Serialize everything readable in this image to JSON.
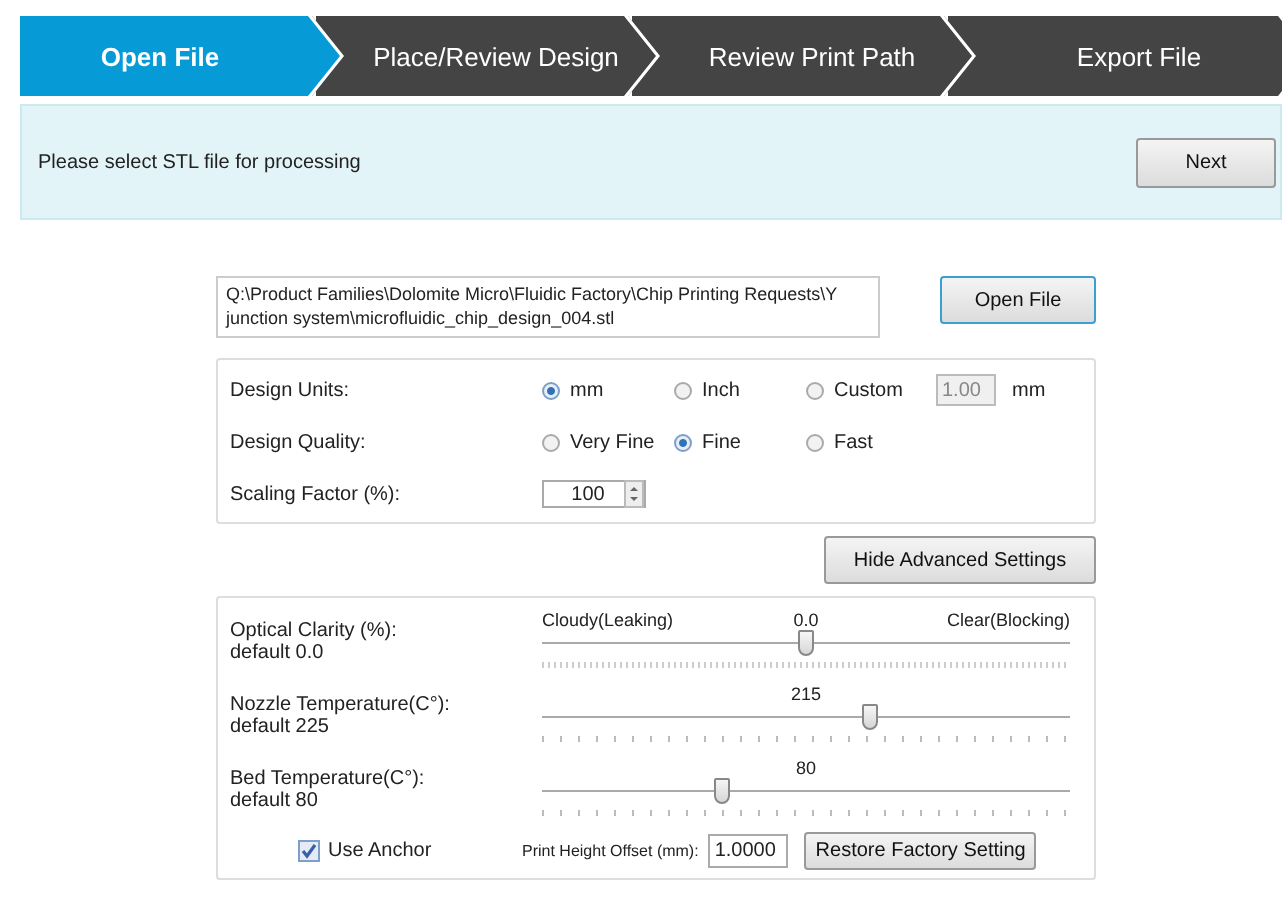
{
  "steps": [
    {
      "label": "Open File",
      "selected": true
    },
    {
      "label": "Place/Review Design",
      "selected": false
    },
    {
      "label": "Review Print Path",
      "selected": false
    },
    {
      "label": "Export File",
      "selected": false
    }
  ],
  "banner": {
    "message": "Please select STL file for processing",
    "button": "Next"
  },
  "file": {
    "path": "Q:\\Product Families\\Dolomite Micro\\Fluidic Factory\\Chip Printing Requests\\Y junction system\\microfluidic_chip_design_004.stl",
    "button": "Open File"
  },
  "design": {
    "units": {
      "label": "Design Units:",
      "options": [
        {
          "label": "mm",
          "selected": true
        },
        {
          "label": "Inch",
          "selected": false
        },
        {
          "label": "Custom",
          "selected": false
        }
      ],
      "custom_value": "1.00",
      "custom_unit": "mm"
    },
    "quality": {
      "label": "Design Quality:",
      "options": [
        {
          "label": "Very Fine",
          "selected": false
        },
        {
          "label": "Fine",
          "selected": true
        },
        {
          "label": "Fast",
          "selected": false
        }
      ]
    },
    "scaling": {
      "label": "Scaling Factor (%):",
      "value": "100"
    }
  },
  "advanced_button": "Hide Advanced Settings",
  "sliders": [
    {
      "label": "Optical Clarity (%):",
      "default": "default 0.0",
      "reading": "0.0",
      "left_label": "Cloudy(Leaking)",
      "right_label": "Clear(Blocking)",
      "level": 0.5
    },
    {
      "label": "Nozzle Temperature(C°):",
      "default": "default 225",
      "reading": "215",
      "level": 0.62
    },
    {
      "label": "Bed Temperature(C°):",
      "default": "default 80",
      "reading": "80",
      "level": 0.34
    }
  ],
  "anchor": {
    "label": "Use Anchor",
    "checked": true
  },
  "offset": {
    "label": "Print Height Offset (mm):",
    "value": "1.0000"
  },
  "restore_button": "Restore Factory Setting"
}
